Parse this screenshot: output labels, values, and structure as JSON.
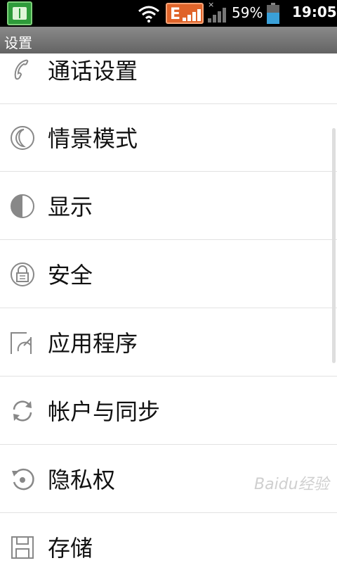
{
  "status_bar": {
    "battery_percent": "59%",
    "battery_level": 0.59,
    "time": "19:05",
    "network_type": "E",
    "network_x": "×",
    "icons": [
      "app-icon",
      "wifi-icon",
      "edge-signal-icon",
      "cell-signal-icon",
      "battery-icon"
    ]
  },
  "title_bar": {
    "title": "设置"
  },
  "settings": {
    "items": [
      {
        "label": "通话设置",
        "icon": "phone-icon"
      },
      {
        "label": "情景模式",
        "icon": "profile-moon-icon"
      },
      {
        "label": "显示",
        "icon": "display-icon"
      },
      {
        "label": "安全",
        "icon": "lock-icon"
      },
      {
        "label": "应用程序",
        "icon": "applications-icon"
      },
      {
        "label": "帐户与同步",
        "icon": "sync-icon"
      },
      {
        "label": "隐私权",
        "icon": "privacy-icon"
      },
      {
        "label": "存储",
        "icon": "storage-icon"
      }
    ]
  },
  "watermark": {
    "text": "Baidu经验"
  },
  "colors": {
    "status_bar": "#000000",
    "title_bar": "#777777",
    "edge_badge": "#e0642a",
    "battery_fill": "#3aa0d8"
  }
}
